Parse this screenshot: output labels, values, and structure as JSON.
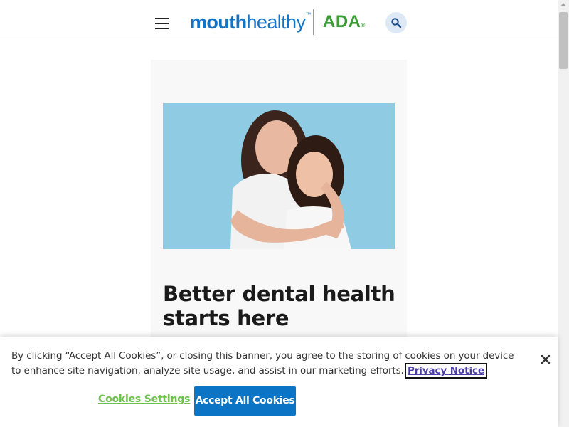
{
  "header": {
    "logo_part1": "mouth",
    "logo_part2": "healthy",
    "logo_tm": "™",
    "ada_logo": "ADA",
    "ada_reg": "®",
    "colors": {
      "brand_blue": "#1273c7",
      "ada_green": "#3a9d35"
    }
  },
  "hero": {
    "title": "Better dental health starts here"
  },
  "cookie_banner": {
    "text": "By clicking “Accept All Cookies”, or closing this banner, you agree to the storing of cookies on your device to enhance site navigation, analyze site usage, and assist in our marketing efforts.",
    "privacy_link": "Privacy Notice",
    "settings_label": "Cookies Settings",
    "accept_label": "Accept All Cookies",
    "close_icon": "close-icon",
    "colors": {
      "accept_bg": "#0b74c4",
      "settings_text": "#6cc24a"
    }
  }
}
